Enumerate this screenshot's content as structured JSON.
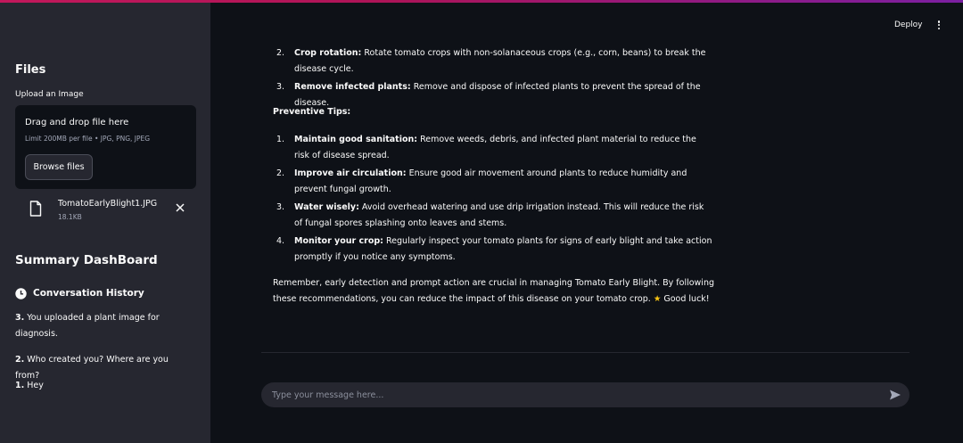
{
  "sidebar": {
    "files_title": "Files",
    "upload_label": "Upload an Image",
    "dropzone": {
      "title": "Drag and drop file here",
      "limit": "Limit 200MB per file • JPG, PNG, JPEG",
      "browse_label": "Browse files"
    },
    "uploaded_file": {
      "name": "TomatoEarlyBlight1.JPG",
      "size": "18.1KB",
      "icon": "file-icon"
    },
    "dashboard_title": "Summary DashBoard",
    "conversation_history": {
      "title": "Conversation History",
      "icon": "clock-icon",
      "items": [
        {
          "num": "3.",
          "text": "You uploaded a plant image for diagnosis."
        },
        {
          "num": "2.",
          "text": "Who created you? Where are you from?"
        },
        {
          "num": "1.",
          "text": "Hey"
        }
      ]
    }
  },
  "header": {
    "deploy_label": "Deploy",
    "menu_icon": "kebab-menu-icon"
  },
  "response": {
    "treatment_items": [
      {
        "num": "2.",
        "bold": "Crop rotation:",
        "text": " Rotate tomato crops with non-solanaceous crops (e.g., corn, beans) to break the disease cycle."
      },
      {
        "num": "3.",
        "bold": "Remove infected plants:",
        "text": " Remove and dispose of infected plants to prevent the spread of the disease."
      }
    ],
    "preventive_heading": "Preventive Tips:",
    "preventive_items": [
      {
        "num": "1.",
        "bold": "Maintain good sanitation:",
        "text": " Remove weeds, debris, and infected plant material to reduce the risk of disease spread."
      },
      {
        "num": "2.",
        "bold": "Improve air circulation:",
        "text": " Ensure good air movement around plants to reduce humidity and prevent fungal growth."
      },
      {
        "num": "3.",
        "bold": "Water wisely:",
        "text": " Avoid overhead watering and use drip irrigation instead. This will reduce the risk of fungal spores splashing onto leaves and stems."
      },
      {
        "num": "4.",
        "bold": "Monitor your crop:",
        "text": " Regularly inspect your tomato plants for signs of early blight and take action promptly if you notice any symptoms."
      }
    ],
    "closing_text": "Remember, early detection and prompt action are crucial in managing Tomato Early Blight. By following these recommendations, you can reduce the impact of this disease on your tomato crop.",
    "closing_star": "★",
    "closing_end": "Good luck!"
  },
  "chat": {
    "placeholder": "Type your message here...",
    "send_icon": "send-icon"
  },
  "colors": {
    "sidebar_bg": "#262730",
    "main_bg": "#0e1117",
    "accent_gradient_start": "#c2185b",
    "accent_gradient_end": "#7b1fa2",
    "star": "#f9c513"
  }
}
